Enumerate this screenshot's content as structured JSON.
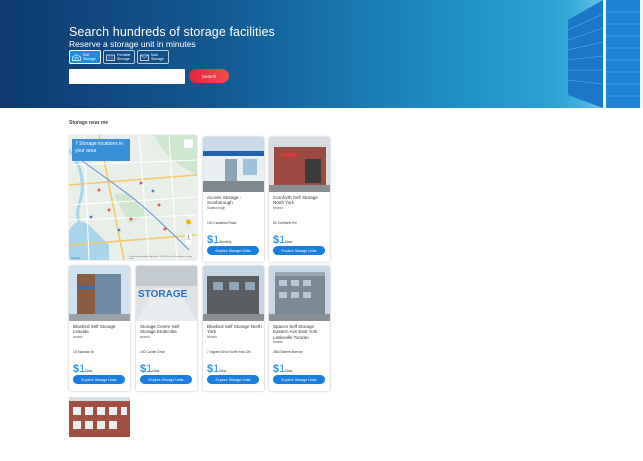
{
  "hero": {
    "title": "Search hundreds of storage facilities",
    "subtitle": "Reserve a storage unit in minutes",
    "tabs": [
      {
        "icon": "self-storage-icon",
        "label": "Self Storage",
        "active": true
      },
      {
        "icon": "portable-storage-icon",
        "label": "Portable Storage",
        "active": false
      },
      {
        "icon": "mail-storage-icon",
        "label": "Mail Storage",
        "active": false
      }
    ],
    "search_value": "",
    "search_button": "Search"
  },
  "section_title": "Storage near me",
  "map": {
    "badge": "7 Storage locations in your area",
    "footer": "Keyboard shortcuts   Map data ©2023   Terms of Use   Report a map error",
    "google": "Google"
  },
  "cards": [
    {
      "name": "Access Storage - Scarborough",
      "city": "Scarborough",
      "address": "100 Canadian Road",
      "price": "1",
      "unit": "Monthly",
      "button": "Explore Storage Units"
    },
    {
      "name": "Cornforth Self Storage North York",
      "city": "toronto",
      "address": "82 Cornforth Rd",
      "price": "1",
      "unit": "Now",
      "button": "Explore Storage Units"
    },
    {
      "name": "Bluebird Self Storage Leaside",
      "city": "toronto",
      "address": "15 Esandar Dr",
      "price": "1",
      "unit": "Now",
      "button": "Explore Storage Units"
    },
    {
      "name": "Storage Centre Self Storage Etobicoke",
      "city": "toronto",
      "address": "100 Carrier Drive",
      "price": "1",
      "unit": "Now",
      "button": "Explore Storage Units"
    },
    {
      "name": "Bluebird Self Storage North York",
      "city": "toronto",
      "address": "7 Ingram Drive North York ON",
      "price": "1",
      "unit": "Now",
      "button": "Explore Storage Units"
    },
    {
      "name": "Spaces Self Storage Eastern Ave East York Leslieville Toronto",
      "city": "toronto",
      "address": "358 Eastern Avenue",
      "price": "1",
      "unit": "Now",
      "button": "Explore Storage Units"
    }
  ],
  "photo_text": {
    "storage_sign": "STORAGE"
  },
  "colors": {
    "accent_blue": "#1a7ee0",
    "price_blue": "#2a8fe3",
    "search_red": "#e8233a",
    "hero_dark": "#0e3a6e"
  }
}
